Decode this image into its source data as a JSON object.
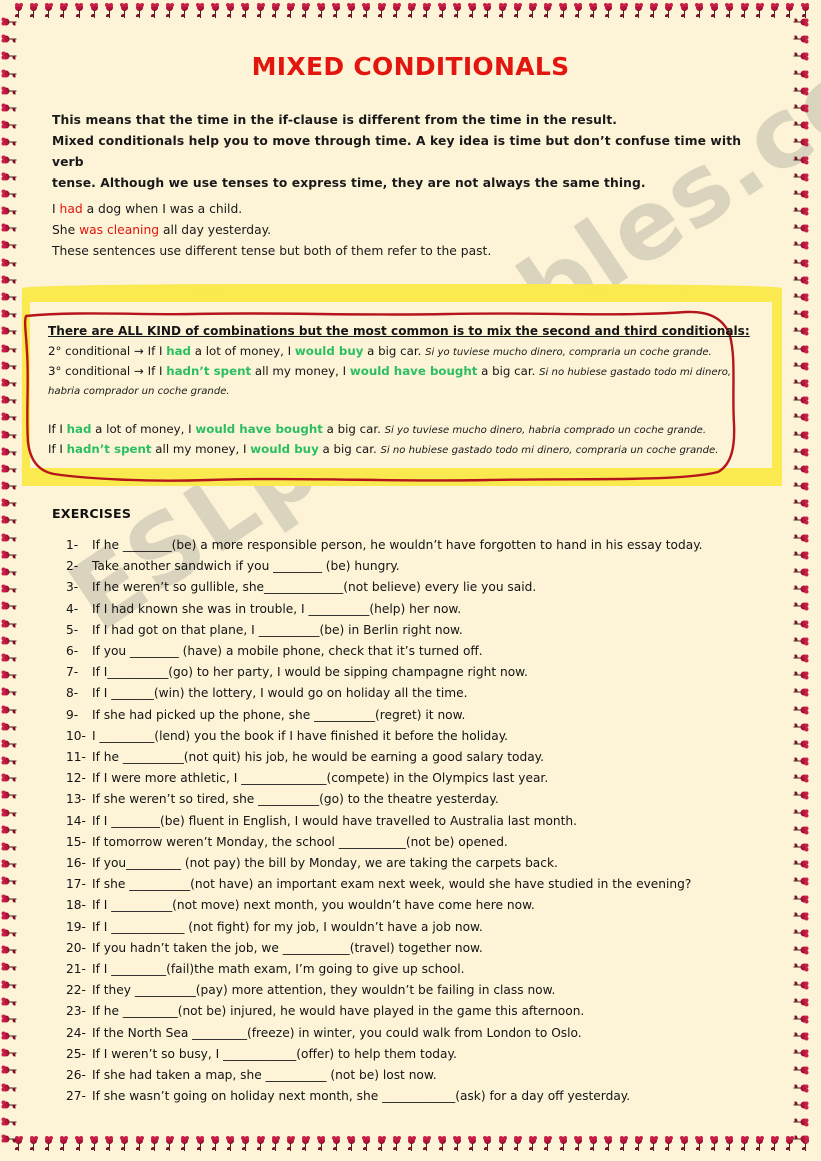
{
  "page": {
    "background_color": "#FDF3D7",
    "title": "MIXED CONDITIONALS",
    "title_color": "#E2150F",
    "watermark": "ESLprintables.com",
    "border_motif": "heart-flower-icon",
    "border_motif_color": "#B9123B"
  },
  "intro": {
    "line1": "This means that the time in the if-clause is different from the time in the result.",
    "line2": "Mixed conditionals help you to move through time. A key idea is time but don’t confuse time with verb",
    "line3": "tense. Although we use tenses to express time, they are not always the same thing."
  },
  "examples": {
    "ex1_pre": "I ",
    "ex1_hl": "had",
    "ex1_post": " a dog when I was a child.",
    "ex2_pre": "She ",
    "ex2_hl": "was cleaning",
    "ex2_post": " all day yesterday.",
    "ex3": "These sentences use different tense but both of them refer to the past.",
    "highlight_color": "#E2150F"
  },
  "rulebox": {
    "heading": "There are ALL KIND of combinations but the most common is to mix the second and third conditionals:",
    "highlight_band_color": "#FAE94F",
    "frame_color": "#B5151B",
    "green_color": "#2BBF62",
    "second": {
      "label": "2° conditional → If I ",
      "verb1": "had",
      "mid": " a lot of money, I ",
      "verb2": "would buy",
      "tail": " a big car. ",
      "spanish": "Si yo tuviese mucho dinero, compraria un coche grande."
    },
    "third": {
      "label": "3° conditional → If I ",
      "verb1": "hadn’t spent",
      "mid": " all my money, I ",
      "verb2": "would have bought",
      "tail": " a big car. ",
      "spanish": "Si no hubiese gastado todo mi dinero,",
      "spanish_cont": "habria comprador un coche grande."
    },
    "mixed1": {
      "label": "If I ",
      "verb1": "had",
      "mid": " a lot of money, I ",
      "verb2": "would have bought",
      "tail": " a big car. ",
      "spanish": "Si yo tuviese mucho dinero, habria comprado un coche grande."
    },
    "mixed2": {
      "label": "If I ",
      "verb1": "hadn’t spent",
      "mid": " all my money, I ",
      "verb2": "would buy",
      "tail": " a big car. ",
      "spanish": "Si no hubiese gastado todo mi dinero, compraria un coche grande."
    }
  },
  "exercises": {
    "heading": "EXERCISES",
    "items": [
      {
        "num": "1-",
        "text": "If he ________(be) a more responsible person, he wouldn’t have forgotten to hand in his essay today."
      },
      {
        "num": "2-",
        "text": "Take another sandwich if you  ________ (be) hungry."
      },
      {
        "num": "3-",
        "text": "If he weren’t so gullible, she_____________(not believe) every lie you said."
      },
      {
        "num": "4-",
        "text": "If I had known she was in trouble, I __________(help) her now."
      },
      {
        "num": "5-",
        "text": "If I had got on that plane, I __________(be) in Berlin right now."
      },
      {
        "num": "6-",
        "text": "If you ________ (have) a mobile phone, check that it’s turned off."
      },
      {
        "num": "7-",
        "text": "If I__________(go) to her party, I would be sipping champagne right now."
      },
      {
        "num": "8-",
        "text": "If I _______(win) the lottery, I would go on holiday all the time."
      },
      {
        "num": "9-",
        "text": "If she had picked up the phone, she __________(regret) it now."
      },
      {
        "num": "10-",
        "text": "I _________(lend) you the book if I have finished it before the holiday."
      },
      {
        "num": "11-",
        "text": "If he __________(not quit) his job, he would be earning a good salary today."
      },
      {
        "num": "12-",
        "text": "If I were more athletic, I ______________(compete) in the Olympics last year."
      },
      {
        "num": "13-",
        "text": "If she weren’t so tired, she __________(go) to the theatre yesterday."
      },
      {
        "num": "14-",
        "text": "If I ________(be) fluent in English, I would have travelled to Australia last month."
      },
      {
        "num": "15-",
        "text": "If tomorrow weren’t Monday, the school ___________(not be) opened."
      },
      {
        "num": "16-",
        "text": "If you_________ (not pay) the bill by Monday, we are taking the carpets back."
      },
      {
        "num": "17-",
        "text": "If she __________(not have) an important exam next week, would she have studied in the evening?"
      },
      {
        "num": "18-",
        "text": "If I __________(not move) next month, you wouldn’t have come here now."
      },
      {
        "num": "19-",
        "text": "If I ____________ (not fight) for my job, I wouldn’t have a job now."
      },
      {
        "num": "20-",
        "text": "If you hadn’t taken the job, we ___________(travel) together now."
      },
      {
        "num": "21-",
        "text": "If I _________(fail)the math exam, I’m going to give up school."
      },
      {
        "num": "22-",
        "text": "If they __________(pay) more attention, they wouldn’t be failing in class now."
      },
      {
        "num": "23-",
        "text": "If he _________(not be) injured, he would have played in the game this afternoon."
      },
      {
        "num": "24-",
        "text": "If the North Sea _________(freeze) in winter, you could walk from London to Oslo."
      },
      {
        "num": "25-",
        "text": "If I weren’t so busy, I ____________(offer) to help them today."
      },
      {
        "num": "26-",
        "text": "If she had taken a map, she __________ (not be) lost now."
      },
      {
        "num": "27-",
        "text": "If she wasn’t going on holiday next month, she ____________(ask) for a day off yesterday."
      }
    ]
  }
}
